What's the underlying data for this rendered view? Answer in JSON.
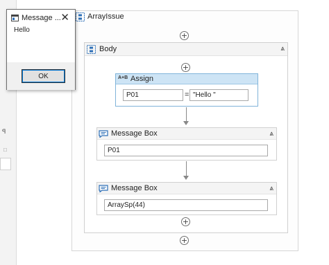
{
  "dialog": {
    "title": "Message ...",
    "message": "Hello",
    "ok_label": "OK"
  },
  "sequence": {
    "title": "ArrayIssue",
    "body": {
      "title": "Body",
      "assign": {
        "title": "Assign",
        "icon_text": "A+B",
        "to_value": "P01",
        "equals": "=",
        "value": "\"Hello \""
      },
      "message_boxes": [
        {
          "title": "Message Box",
          "text": "P01"
        },
        {
          "title": "Message Box",
          "text": "ArraySp(44)"
        }
      ]
    }
  },
  "left_panel": {
    "glyph": "ꟼ",
    "glyph2": "□"
  },
  "icons": {
    "add": "+",
    "collapse": "⩓",
    "close": "✕"
  },
  "colors": {
    "assign_header": "#cde4f5",
    "assign_border": "#7fb3d9",
    "ok_focus": "#0078d7"
  }
}
